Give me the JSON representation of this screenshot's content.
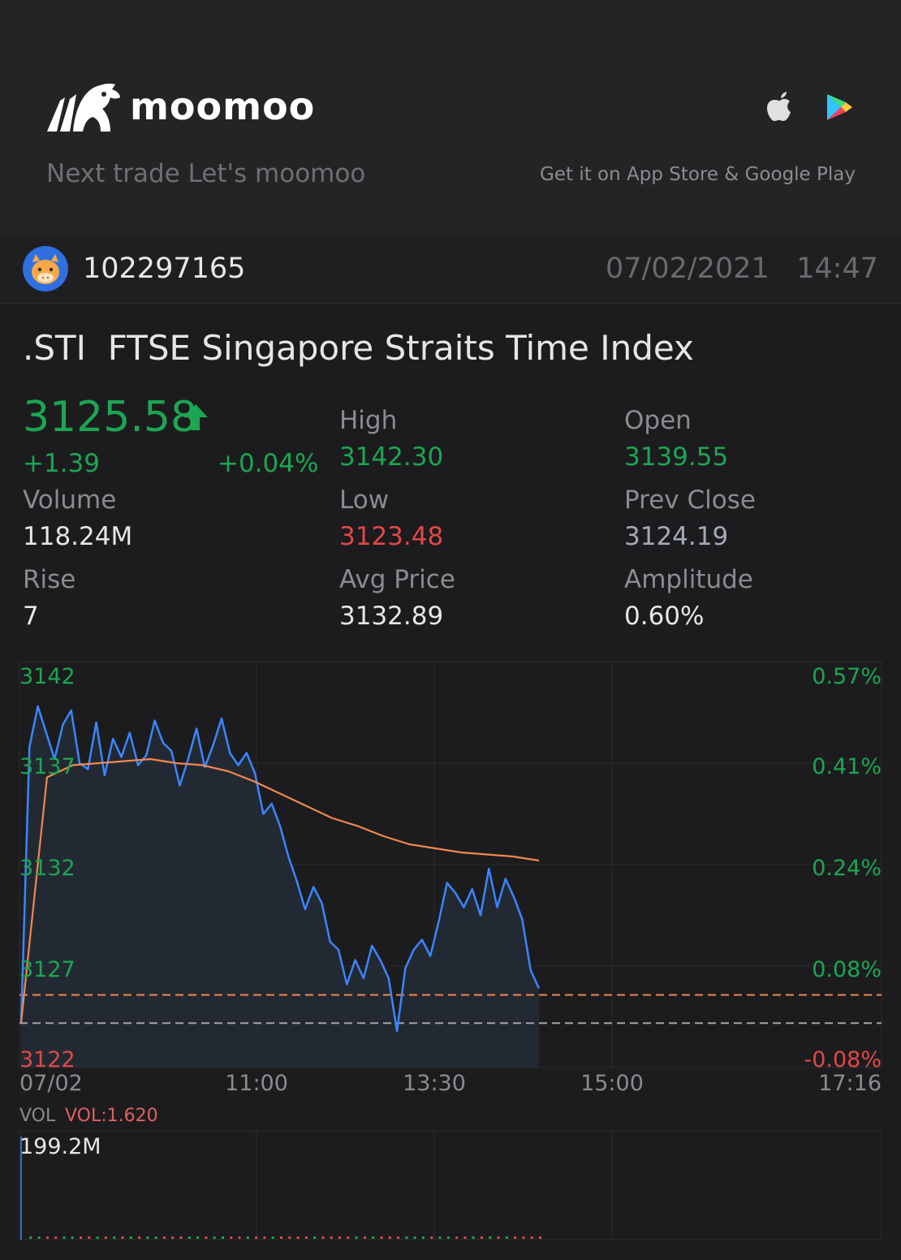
{
  "header": {
    "brand": "moomoo",
    "tagline": "Next trade Let's moomoo",
    "store_text": "Get it on App Store & Google Play"
  },
  "user": {
    "id": "102297165",
    "timestamp": "07/02/2021   14:47"
  },
  "quote": {
    "title": ".STI  FTSE Singapore Straits Time Index",
    "price": "3125.58",
    "change": "+1.39",
    "change_pct": "+0.04%",
    "stats": {
      "volume_label": "Volume",
      "volume": "118.24M",
      "rise_label": "Rise",
      "rise": "7",
      "high_label": "High",
      "high": "3142.30",
      "low_label": "Low",
      "low": "3123.48",
      "avg_label": "Avg Price",
      "avg": "3132.89",
      "open_label": "Open",
      "open": "3139.55",
      "prev_label": "Prev Close",
      "prev": "3124.19",
      "amp_label": "Amplitude",
      "amp": "0.60%"
    }
  },
  "chart": {
    "y_labels": [
      "3142",
      "3137",
      "3132",
      "3127",
      "3122"
    ],
    "pct_labels": [
      "0.57%",
      "0.41%",
      "0.24%",
      "0.08%",
      "-0.08%"
    ],
    "x_labels": [
      "07/02",
      "11:00",
      "13:30",
      "15:00",
      "17:16"
    ],
    "vol_label": "VOL",
    "vol_value": "VOL:1.620",
    "vol_max": "199.2M"
  },
  "chart_data": {
    "type": "line",
    "title": "",
    "xlabel": "",
    "ylabel": "",
    "ylim": [
      3122,
      3142
    ],
    "x_ticks": [
      "07/02",
      "11:00",
      "13:30",
      "15:00",
      "17:16"
    ],
    "prev_close": 3124.19,
    "last_price": 3125.58,
    "series": [
      {
        "type": "price",
        "color": "#3a86ff",
        "values": [
          3124.2,
          3137.8,
          3139.8,
          3138.5,
          3137.2,
          3138.9,
          3139.6,
          3137.0,
          3136.7,
          3139.0,
          3136.4,
          3138.2,
          3137.3,
          3138.5,
          3136.9,
          3137.4,
          3139.1,
          3138.0,
          3137.6,
          3135.9,
          3137.2,
          3138.7,
          3136.8,
          3137.9,
          3139.2,
          3137.5,
          3136.9,
          3137.5,
          3136.5,
          3134.5,
          3135.0,
          3133.9,
          3132.4,
          3131.2,
          3129.8,
          3130.9,
          3130.1,
          3128.2,
          3127.8,
          3126.1,
          3127.3,
          3126.4,
          3128.0,
          3127.3,
          3126.4,
          3123.8,
          3126.9,
          3127.8,
          3128.3,
          3127.5,
          3129.2,
          3131.1,
          3130.6,
          3129.9,
          3130.8,
          3129.5,
          3131.8,
          3129.9,
          3131.3,
          3130.4,
          3129.3,
          3126.8,
          3125.9
        ]
      },
      {
        "type": "average",
        "color": "#f0884f",
        "values": [
          3124.2,
          3136.3,
          3136.9,
          3137.0,
          3137.1,
          3137.2,
          3137.0,
          3136.9,
          3136.6,
          3136.1,
          3135.5,
          3134.9,
          3134.3,
          3133.9,
          3133.4,
          3133.0,
          3132.8,
          3132.6,
          3132.5,
          3132.4,
          3132.2
        ]
      }
    ],
    "annotations": [
      "3125.58 (last price line)",
      "3124.19 (prev close line)"
    ]
  }
}
